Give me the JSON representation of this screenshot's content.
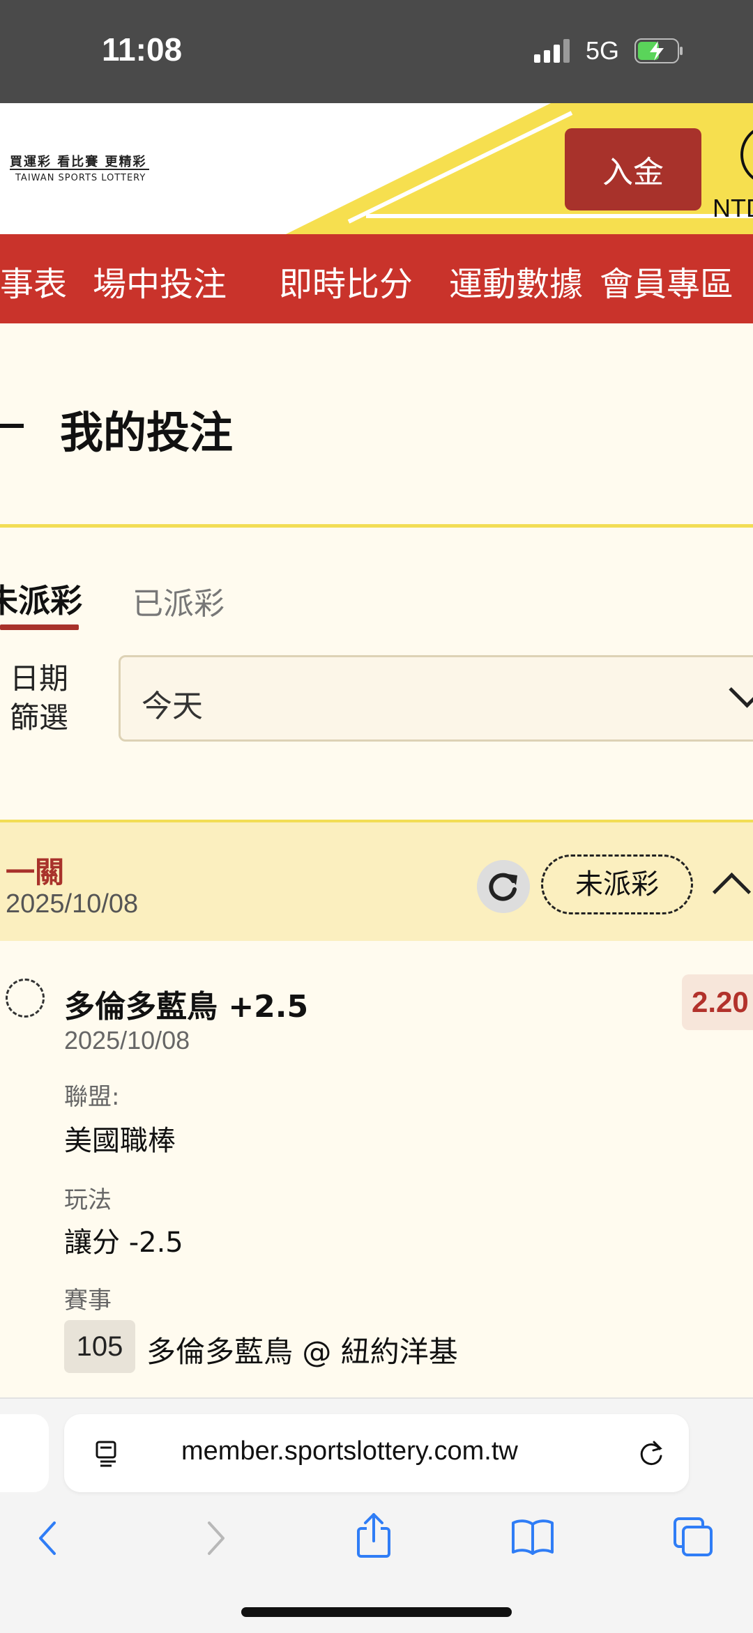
{
  "status_bar": {
    "time": "11:08",
    "network": "5G"
  },
  "header": {
    "logo_line1": "買運彩 看比賽 更精彩",
    "logo_line2": "TAIWAN SPORTS LOTTERY",
    "deposit_label": "入金",
    "currency": "NTD"
  },
  "nav": {
    "items": [
      "賽事表",
      "場中投注",
      "即時比分",
      "運動數據",
      "會員專區"
    ]
  },
  "page": {
    "title": "我的投注"
  },
  "tabs": {
    "active": "未派彩",
    "inactive": "已派彩"
  },
  "filter": {
    "label_line1": "日期",
    "label_line2": "篩選",
    "value": "今天"
  },
  "bet": {
    "type": "一關",
    "date": "2025/10/08",
    "status": "未派彩",
    "selection": "多倫多藍鳥 +2.5",
    "selection_date": "2025/10/08",
    "odds": "2.20",
    "league_label": "聯盟:",
    "league_value": "美國職棒",
    "play_label": "玩法",
    "play_value": "讓分 -2.5",
    "match_label": "賽事",
    "match_no": "105",
    "match_name": "多倫多藍鳥 @ 紐約洋基"
  },
  "browser": {
    "url": "member.sportslottery.com.tw"
  },
  "colors": {
    "brand_red": "#c9332b",
    "accent_yellow": "#f2dd55",
    "deposit_red": "#a8322b"
  }
}
